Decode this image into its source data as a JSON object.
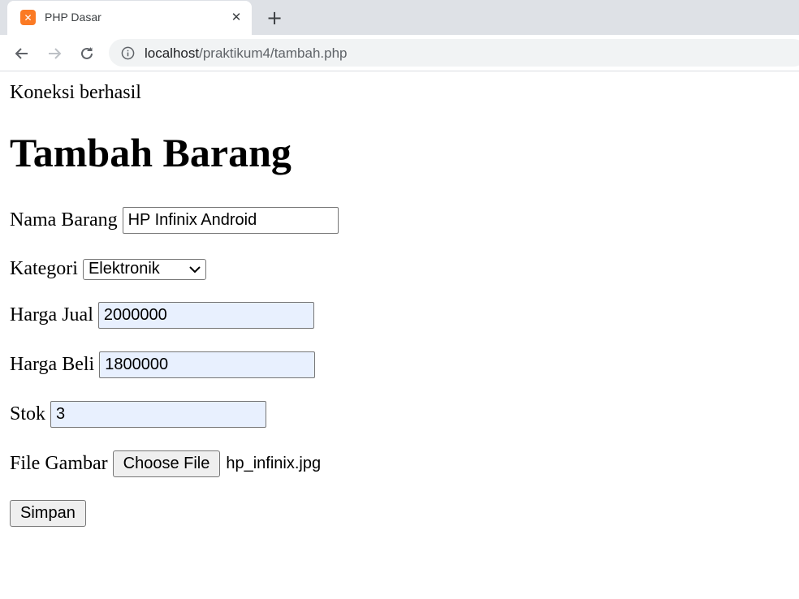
{
  "browser": {
    "tab_title": "PHP Dasar",
    "favicon_icon": "xampp-icon",
    "url_host": "localhost",
    "url_path": "/praktikum4/tambah.php"
  },
  "page": {
    "status_text": "Koneksi berhasil",
    "heading": "Tambah Barang",
    "form": {
      "nama_label": "Nama Barang",
      "nama_value": "HP Infinix Android",
      "kategori_label": "Kategori",
      "kategori_value": "Elektronik",
      "harga_jual_label": "Harga Jual",
      "harga_jual_value": "2000000",
      "harga_beli_label": "Harga Beli",
      "harga_beli_value": "1800000",
      "stok_label": "Stok",
      "stok_value": "3",
      "file_label": "File Gambar",
      "file_button": "Choose File",
      "file_name": "hp_infinix.jpg",
      "submit_label": "Simpan"
    }
  },
  "colors": {
    "autofill_bg": "#e8f0fe",
    "tabstrip_bg": "#dee1e6",
    "favicon": "#fb7a24"
  }
}
